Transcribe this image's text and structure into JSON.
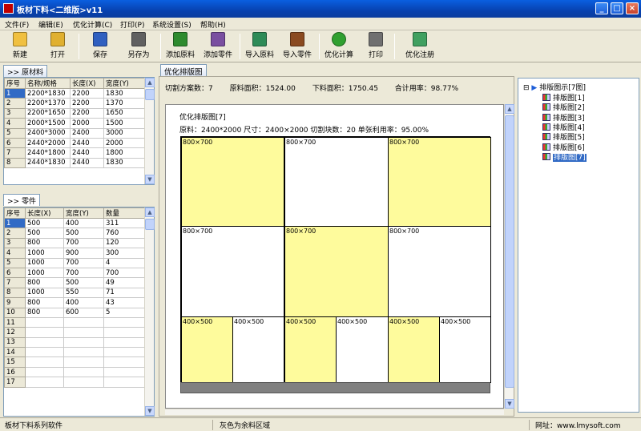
{
  "window": {
    "title": "板材下料<二维版>v11",
    "buttons": [
      "_",
      "□",
      "×"
    ]
  },
  "menu": [
    "文件(F)",
    "编辑(E)",
    "优化计算(C)",
    "打印(P)",
    "系统设置(S)",
    "帮助(H)"
  ],
  "toolbar": [
    {
      "label": "新建",
      "icon": "new-file-icon",
      "color": "#f0c040"
    },
    {
      "label": "打开",
      "icon": "open-folder-icon",
      "color": "#e0b030"
    },
    {
      "label": "保存",
      "icon": "save-icon",
      "color": "#3060c0"
    },
    {
      "label": "另存为",
      "icon": "save-as-icon",
      "color": "#606060"
    },
    {
      "label": "添加原料",
      "icon": "add-material-icon",
      "color": "#2e8b2e"
    },
    {
      "label": "添加零件",
      "icon": "add-part-icon",
      "color": "#7a4fa0"
    },
    {
      "label": "导入原料",
      "icon": "import-material-icon",
      "color": "#2e8b57"
    },
    {
      "label": "导入零件",
      "icon": "import-part-icon",
      "color": "#8a4a20"
    },
    {
      "label": "优化计算",
      "icon": "check-icon",
      "color": "#30a030"
    },
    {
      "label": "打印",
      "icon": "printer-icon",
      "color": "#707070"
    },
    {
      "label": "优化注册",
      "icon": "register-icon",
      "color": "#40a060"
    }
  ],
  "materials": {
    "tab": ">> 原材料",
    "columns": [
      "序号",
      "名称/规格",
      "长度(X)",
      "宽度(Y)"
    ],
    "rows": [
      [
        "1",
        "2200*1830",
        "2200",
        "1830"
      ],
      [
        "2",
        "2200*1370",
        "2200",
        "1370"
      ],
      [
        "3",
        "2200*1650",
        "2200",
        "1650"
      ],
      [
        "4",
        "2000*1500",
        "2000",
        "1500"
      ],
      [
        "5",
        "2400*3000",
        "2400",
        "3000"
      ],
      [
        "6",
        "2440*2000",
        "2440",
        "2000"
      ],
      [
        "7",
        "2440*1800",
        "2440",
        "1800"
      ],
      [
        "8",
        "2440*1830",
        "2440",
        "1830"
      ]
    ]
  },
  "parts": {
    "tab": ">> 零件",
    "columns": [
      "序号",
      "长度(X)",
      "宽度(Y)",
      "数量"
    ],
    "rows": [
      [
        "1",
        "500",
        "400",
        "311"
      ],
      [
        "2",
        "500",
        "500",
        "760"
      ],
      [
        "3",
        "800",
        "700",
        "120"
      ],
      [
        "4",
        "1000",
        "900",
        "300"
      ],
      [
        "5",
        "1000",
        "700",
        "4"
      ],
      [
        "6",
        "1000",
        "700",
        "700"
      ],
      [
        "7",
        "800",
        "500",
        "49"
      ],
      [
        "8",
        "1000",
        "550",
        "71"
      ],
      [
        "9",
        "800",
        "400",
        "43"
      ],
      [
        "10",
        "800",
        "600",
        "5"
      ],
      [
        "11",
        "",
        "",
        ""
      ],
      [
        "12",
        "",
        "",
        ""
      ],
      [
        "13",
        "",
        "",
        ""
      ],
      [
        "14",
        "",
        "",
        ""
      ],
      [
        "15",
        "",
        "",
        ""
      ],
      [
        "16",
        "",
        "",
        ""
      ],
      [
        "17",
        "",
        "",
        ""
      ]
    ]
  },
  "layout": {
    "tab": "优化排版图",
    "stats": {
      "schemes": "切割方案数：7",
      "material_area": "原料面积：1524.00",
      "part_area": "下料面积：1750.45",
      "utilization": "合计用率：98.77%"
    },
    "sheet_title": "优化排版图[7]",
    "sheet_info": "原料：2400*2000  尺寸：2400×2000  切割块数：20  单张利用率：95.00%",
    "pieces": [
      {
        "label": "800×700",
        "fill": "yellow"
      },
      {
        "label": "800×700",
        "fill": "white"
      },
      {
        "label": "800×700",
        "fill": "yellow"
      },
      {
        "label": "800×700",
        "fill": "white"
      },
      {
        "label": "800×700",
        "fill": "yellow"
      },
      {
        "label": "800×700",
        "fill": "white"
      },
      {
        "label": "400×500",
        "fill": "yellow"
      },
      {
        "label": "400×500",
        "fill": "white"
      },
      {
        "label": "400×500",
        "fill": "yellow"
      },
      {
        "label": "400×500",
        "fill": "white"
      },
      {
        "label": "400×500",
        "fill": "yellow"
      },
      {
        "label": "400×500",
        "fill": "white"
      }
    ]
  },
  "tree": {
    "root": "排版图示[7图]",
    "items": [
      "排版图[1]",
      "排版图[2]",
      "排版图[3]",
      "排版图[4]",
      "排版图[5]",
      "排版图[6]",
      "排版图[7]"
    ],
    "selected": "排版图[7]"
  },
  "status": {
    "left": "板材下料系列软件",
    "middle": "灰色为余料区域",
    "right": "网址：www.lmysoft.com"
  },
  "colors": {
    "part_yellow": "#fefb9c",
    "waste_gray": "#808080",
    "selection_blue": "#316ac5"
  }
}
